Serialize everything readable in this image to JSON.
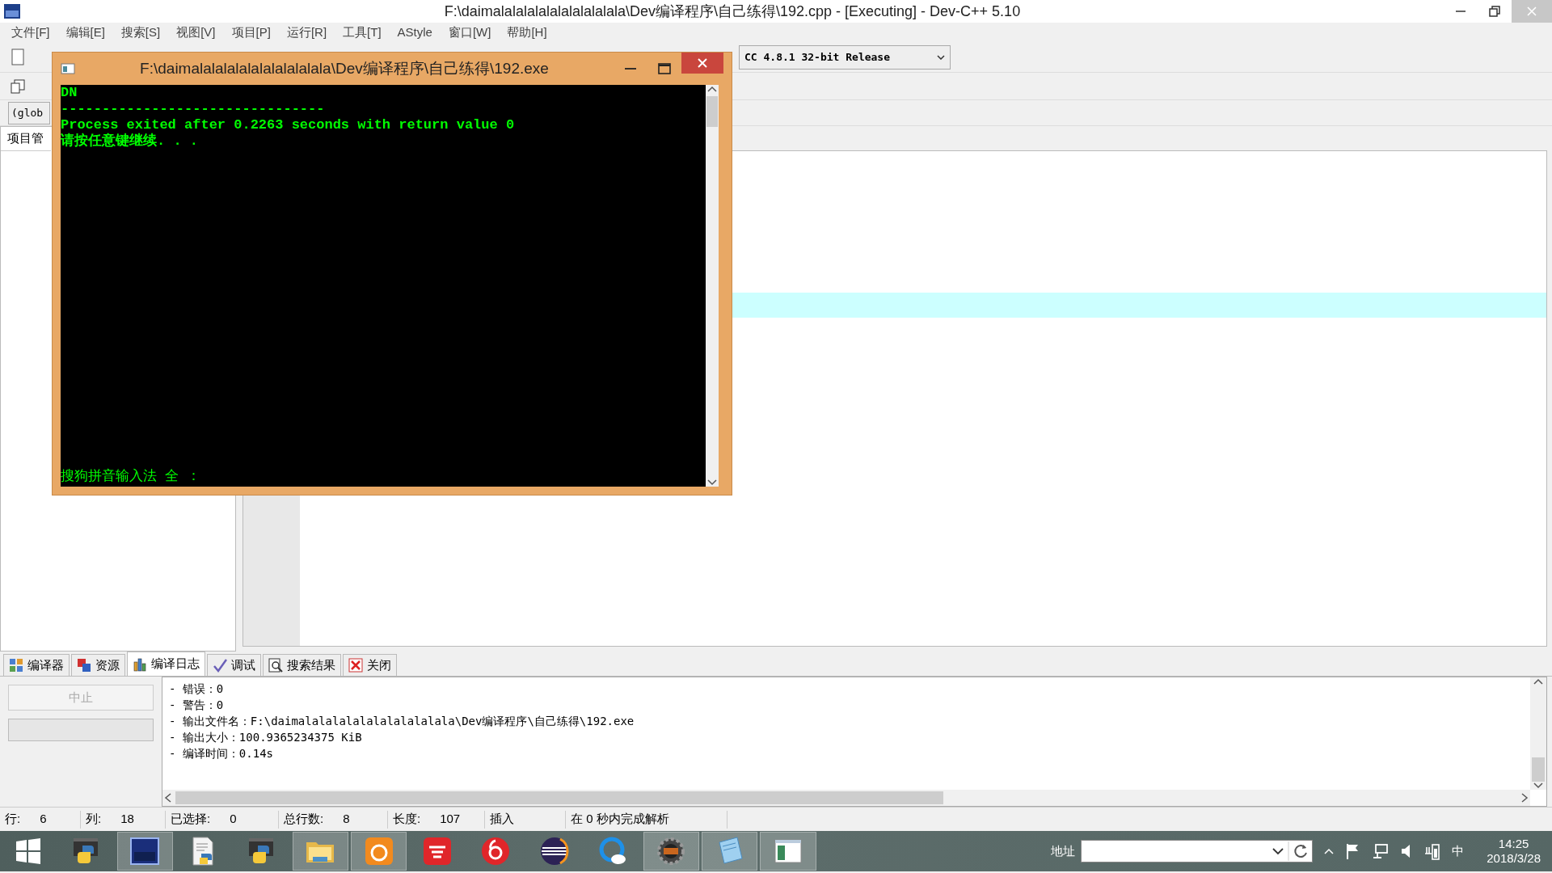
{
  "window": {
    "title": "F:\\daimalalalalalalalalalalala\\Dev编译程序\\自己练得\\192.cpp - [Executing] - Dev-C++ 5.10"
  },
  "menu": [
    "文件[F]",
    "编辑[E]",
    "搜索[S]",
    "视图[V]",
    "项目[P]",
    "运行[R]",
    "工具[T]",
    "AStyle",
    "窗口[W]",
    "帮助[H]"
  ],
  "toolbar": {
    "compiler_select": "CC 4.8.1 32-bit Release",
    "scope_select": "(glob"
  },
  "project_panel": {
    "tab": "项目管"
  },
  "console": {
    "title": "F:\\daimalalalalalalalalalalala\\Dev编译程序\\自己练得\\192.exe",
    "lines": [
      "DN",
      "--------------------------------",
      "Process exited after 0.2263 seconds with return value 0",
      "请按任意键继续. . ."
    ],
    "ime_status": "搜狗拼音输入法 全 ："
  },
  "bottom_tabs": [
    {
      "kind": "grid",
      "label": "编译器",
      "selected": false
    },
    {
      "kind": "resources",
      "label": "资源",
      "selected": false
    },
    {
      "kind": "chart",
      "label": "编译日志",
      "selected": true
    },
    {
      "kind": "check",
      "label": "调试",
      "selected": false
    },
    {
      "kind": "search",
      "label": "搜索结果",
      "selected": false
    },
    {
      "kind": "close",
      "label": "关闭",
      "selected": false
    }
  ],
  "abort_button": {
    "label": "中止",
    "disabled": true
  },
  "compile_log": [
    "- 错误：0",
    "- 警告：0",
    "- 输出文件名：F:\\daimalalalalalalalalalalala\\Dev编译程序\\自己练得\\192.exe",
    "- 输出大小：100.9365234375 KiB",
    "- 编译时间：0.14s"
  ],
  "status_bar": [
    {
      "label": "行:",
      "value": "6"
    },
    {
      "label": "列:",
      "value": "18"
    },
    {
      "label": "已选择:",
      "value": "0"
    },
    {
      "label": "总行数:",
      "value": "8"
    },
    {
      "label": "长度:",
      "value": "107"
    },
    {
      "label": "插入"
    },
    {
      "label": "在 0 秒内完成解析"
    }
  ],
  "taskbar": {
    "apps": [
      {
        "kind": "python",
        "running": false
      },
      {
        "kind": "dev",
        "running": true
      },
      {
        "kind": "pydoc",
        "running": false
      },
      {
        "kind": "python",
        "running": false
      },
      {
        "kind": "folder",
        "running": true
      },
      {
        "kind": "uc",
        "running": true
      },
      {
        "kind": "youdao",
        "running": false
      },
      {
        "kind": "netease",
        "running": false
      },
      {
        "kind": "eclipse",
        "running": false
      },
      {
        "kind": "browser",
        "running": false
      },
      {
        "kind": "gear",
        "running": true
      },
      {
        "kind": "notepad",
        "running": true
      },
      {
        "kind": "window",
        "running": true
      }
    ],
    "address_label": "地址",
    "ime": "中",
    "time": "14:25",
    "date": "2018/3/28"
  }
}
